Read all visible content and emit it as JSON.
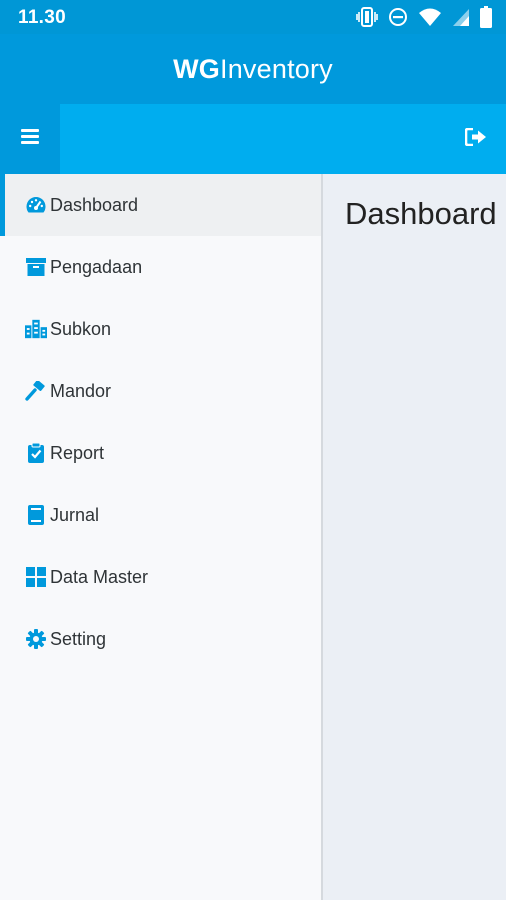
{
  "status_bar": {
    "time": "11.30",
    "icons": [
      "vibrate-icon",
      "do-not-disturb-icon",
      "wifi-icon",
      "signal-icon",
      "battery-icon"
    ]
  },
  "app": {
    "brand_bold": "WG",
    "brand_regular": "Inventory"
  },
  "toolbar": {
    "menu_icon": "hamburger-menu-icon",
    "logout_icon": "sign-out-icon"
  },
  "sidebar": {
    "items": [
      {
        "label": "Dashboard",
        "icon": "dashboard-gauge-icon",
        "active": true
      },
      {
        "label": "Pengadaan",
        "icon": "archive-box-icon",
        "active": false
      },
      {
        "label": "Subkon",
        "icon": "city-buildings-icon",
        "active": false
      },
      {
        "label": "Mandor",
        "icon": "gavel-icon",
        "active": false
      },
      {
        "label": "Report",
        "icon": "clipboard-check-icon",
        "active": false
      },
      {
        "label": "Jurnal",
        "icon": "book-icon",
        "active": false
      },
      {
        "label": "Data Master",
        "icon": "windows-grid-icon",
        "active": false
      },
      {
        "label": "Setting",
        "icon": "gear-icon",
        "active": false
      }
    ]
  },
  "main": {
    "title": "Dashboard"
  },
  "colors": {
    "accent": "#0099dc",
    "toolbar": "#00adef",
    "statusbar": "#0097d6",
    "sidebar_bg": "#f8f9fb",
    "content_bg": "#ebeff5"
  }
}
